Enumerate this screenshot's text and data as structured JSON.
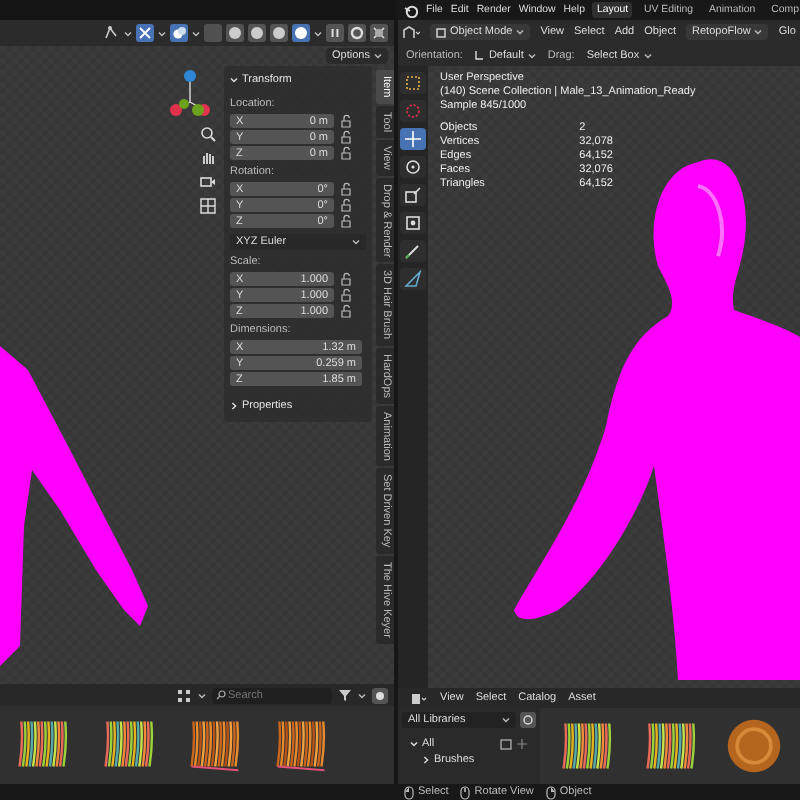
{
  "left_editor": {
    "shading_modes": [
      {
        "selected": false
      },
      {
        "selected": false
      },
      {
        "selected": false
      },
      {
        "selected": true
      }
    ],
    "options": "Options",
    "transform_panel": {
      "title": "Transform",
      "groups": [
        {
          "kind": "locked",
          "label": "Location:",
          "rows": [
            {
              "axis": "X",
              "value": "0 m"
            },
            {
              "axis": "Y",
              "value": "0 m"
            },
            {
              "axis": "Z",
              "value": "0 m"
            }
          ]
        },
        {
          "kind": "locked",
          "label": "Rotation:",
          "rows": [
            {
              "axis": "X",
              "value": "0°"
            },
            {
              "axis": "Y",
              "value": "0°"
            },
            {
              "axis": "Z",
              "value": "0°"
            }
          ]
        },
        {
          "kind": "dropdown",
          "value": "XYZ Euler"
        },
        {
          "kind": "locked",
          "label": "Scale:",
          "rows": [
            {
              "axis": "X",
              "value": "1.000"
            },
            {
              "axis": "Y",
              "value": "1.000"
            },
            {
              "axis": "Z",
              "value": "1.000"
            }
          ]
        },
        {
          "kind": "plain",
          "label": "Dimensions:",
          "rows": [
            {
              "axis": "X",
              "value": "1.32 m"
            },
            {
              "axis": "Y",
              "value": "0.259 m"
            },
            {
              "axis": "Z",
              "value": "1.85 m"
            }
          ]
        }
      ],
      "subpanel": {
        "label": "Properties",
        "expanded": false
      }
    },
    "sidebar_tabs": [
      {
        "label": "Item",
        "selected": true
      },
      {
        "label": "Tool",
        "selected": false
      },
      {
        "label": "View",
        "selected": false
      },
      {
        "label": "Drop & Render",
        "selected": false
      },
      {
        "label": "3D Hair Brush",
        "selected": false
      },
      {
        "label": "HardOps",
        "selected": false
      },
      {
        "label": "Animation",
        "selected": false
      },
      {
        "label": "Set Driven Key",
        "selected": false
      },
      {
        "label": "The Hive Keyer",
        "selected": false
      }
    ],
    "asset_browser": {
      "search_placeholder": "Search",
      "assets": [
        {
          "kind": "multicolor"
        },
        {
          "kind": "multicolor"
        },
        {
          "kind": "orange"
        },
        {
          "kind": "orange"
        }
      ]
    }
  },
  "right_editor": {
    "menu": [
      "File",
      "Edit",
      "Render",
      "Window",
      "Help"
    ],
    "workspaces": [
      {
        "label": "Layout",
        "selected": true
      },
      {
        "label": "UV Editing",
        "selected": false
      },
      {
        "label": "Animation",
        "selected": false
      },
      {
        "label": "Comp",
        "selected": false
      }
    ],
    "mode": "Object Mode",
    "header_menu": [
      "View",
      "Select",
      "Add",
      "Object"
    ],
    "addon": "RetopoFlow",
    "cut_item": "Glo",
    "orientation_label": "Orientation:",
    "orientation": "Default",
    "drag_label": "Drag:",
    "drag": "Select Box",
    "tools": [
      {
        "kind": "select",
        "selected": false
      },
      {
        "kind": "cursor",
        "selected": false
      },
      {
        "kind": "move",
        "selected": true
      },
      {
        "kind": "rotate",
        "selected": false
      },
      {
        "kind": "scale",
        "selected": false
      },
      {
        "kind": "transform",
        "selected": false
      },
      {
        "kind": "annotate",
        "selected": false
      },
      {
        "kind": "measure",
        "selected": false
      }
    ],
    "overlay": {
      "lines": [
        "User Perspective",
        "(140) Scene Collection | Male_13_Animation_Ready",
        "Sample 845/1000"
      ],
      "stats": [
        {
          "label": "Objects",
          "value": "2"
        },
        {
          "label": "Vertices",
          "value": "32,078"
        },
        {
          "label": "Edges",
          "value": "64,152"
        },
        {
          "label": "Faces",
          "value": "32,076"
        },
        {
          "label": "Triangles",
          "value": "64,152"
        }
      ]
    },
    "asset_browser": {
      "menu": [
        "View",
        "Select",
        "Catalog",
        "Asset"
      ],
      "library": "All Libraries",
      "tree": [
        {
          "label": "All",
          "expanded": true,
          "children": [
            {
              "label": "Brushes",
              "expanded": false
            }
          ]
        }
      ],
      "assets": [
        {
          "kind": "multicolor"
        },
        {
          "kind": "multicolor"
        },
        {
          "kind": "wood"
        }
      ]
    }
  },
  "status_bar": [
    {
      "kind": "left",
      "label": "Select"
    },
    {
      "kind": "middle",
      "label": "Rotate View"
    },
    {
      "kind": "right",
      "label": "Object"
    }
  ]
}
